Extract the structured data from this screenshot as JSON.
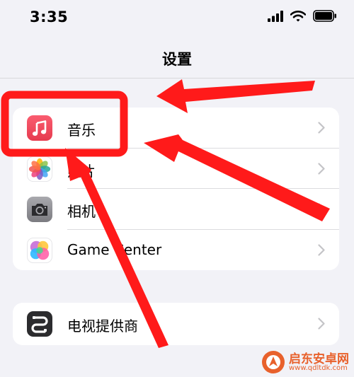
{
  "status_bar": {
    "time": "3:35",
    "icons": [
      "cellular-signal-icon",
      "wifi-icon",
      "battery-icon"
    ]
  },
  "nav": {
    "title": "设置"
  },
  "groups": [
    {
      "rows": [
        {
          "label": "音乐",
          "icon": "music-app-icon",
          "icon_color": "#f1455b"
        },
        {
          "label": "照片",
          "icon": "photos-app-icon"
        },
        {
          "label": "相机",
          "icon": "camera-app-icon",
          "icon_color": "#8e8e93"
        },
        {
          "label": "Game Center",
          "icon": "game-center-icon"
        }
      ]
    },
    {
      "rows": [
        {
          "label": "电视提供商",
          "icon": "tv-provider-icon",
          "icon_color": "#2c2c2e"
        }
      ]
    }
  ],
  "annotation": {
    "color": "#ff1a1a",
    "highlighted_item": "音乐"
  },
  "watermark": {
    "title": "启东安卓网",
    "url": "www.qdltdk.com"
  }
}
